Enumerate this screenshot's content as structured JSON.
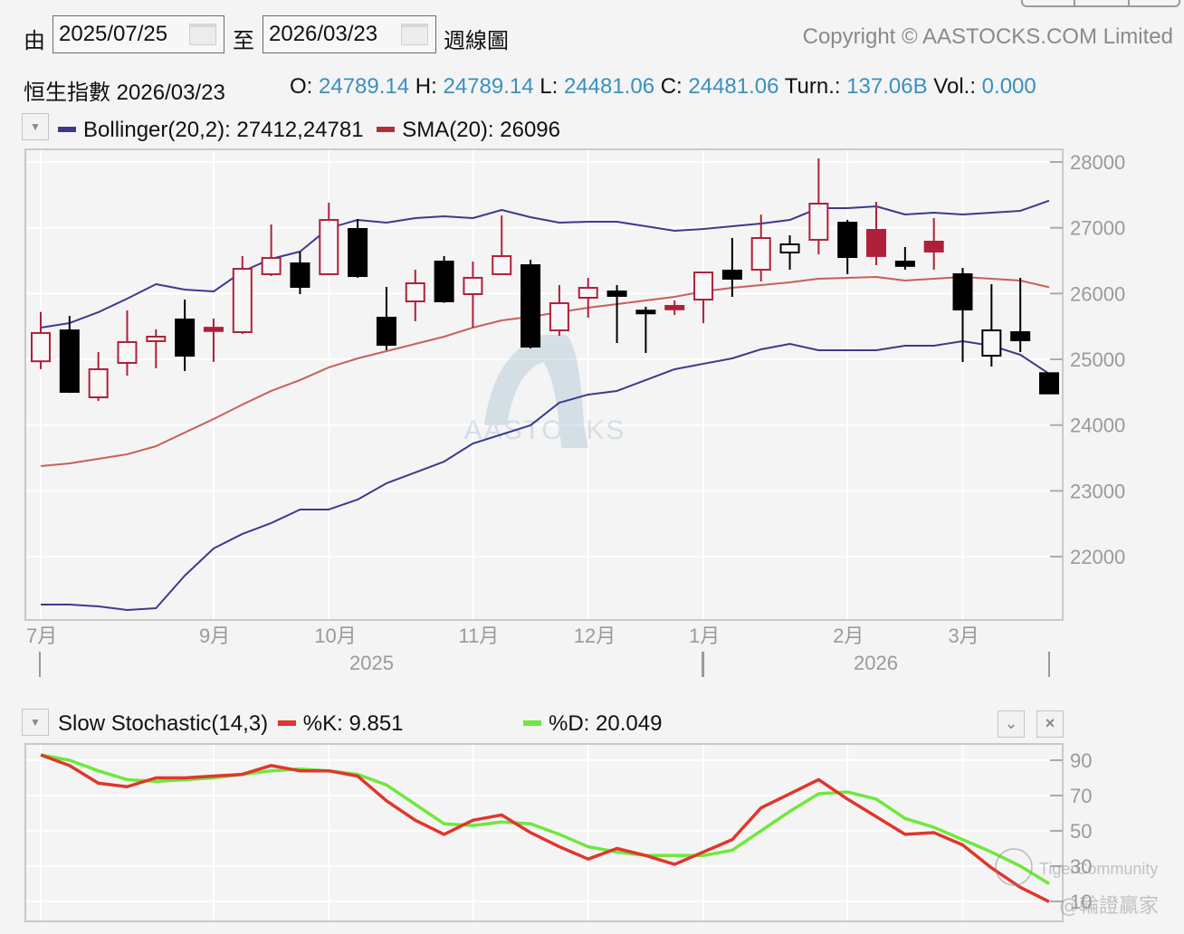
{
  "controls": {
    "from_label": "由",
    "from_date": "2025/07/25",
    "to_label": "至",
    "to_date": "2026/03/23",
    "period_label": "週線圖",
    "copyright": "Copyright © AASTOCKS.COM Limited"
  },
  "quote": {
    "name": "恒生指數",
    "date": "2026/03/23",
    "open_label": "O:",
    "open": "24789.14",
    "high_label": "H:",
    "high": "24789.14",
    "low_label": "L:",
    "low": "24481.06",
    "close_label": "C:",
    "close": "24481.06",
    "turn_label": "Turn.:",
    "turn": "137.06B",
    "vol_label": "Vol.:",
    "vol": "0.000"
  },
  "main_legend": {
    "bollinger": "Bollinger(20,2): 27412,24781",
    "sma": "SMA(20): 26096"
  },
  "stoch_legend": {
    "title": "Slow Stochastic(14,3)",
    "k": "%K: 9.851",
    "d": "%D: 20.049"
  },
  "watermarks": {
    "center": "AASTOCKS",
    "tiger": "TigerCommunity",
    "author": "@輪證贏家"
  },
  "colors": {
    "up": "#b0203a",
    "down": "#000000",
    "bollinger": "#3d3a8c",
    "sma": "#c8605a",
    "k": "#e0362c",
    "d": "#6ee83c",
    "quote_value": "#3a8fc0"
  },
  "chart_data": [
    {
      "type": "candlestick",
      "title": "",
      "y_axis": {
        "position": "right",
        "ticks": [
          22000,
          23000,
          24000,
          25000,
          26000,
          27000,
          28000
        ]
      },
      "x_ticks": [
        {
          "label": "7月",
          "index": 0
        },
        {
          "label": "9月",
          "index": 6
        },
        {
          "label": "10月",
          "index": 10
        },
        {
          "label": "11月",
          "index": 15
        },
        {
          "label": "12月",
          "index": 19
        },
        {
          "label": "1月",
          "index": 23
        },
        {
          "label": "2月",
          "index": 28
        },
        {
          "label": "3月",
          "index": 32
        }
      ],
      "years": [
        {
          "label": "2025",
          "from": 0,
          "to": 23
        },
        {
          "label": "2026",
          "from": 23,
          "to": 35
        }
      ],
      "grid": true,
      "ohlc": [
        [
          24970,
          25720,
          24850,
          25400
        ],
        [
          25440,
          25660,
          24490,
          24505
        ],
        [
          24422,
          25110,
          24367,
          24849
        ],
        [
          24945,
          25743,
          24753,
          25262
        ],
        [
          25276,
          25454,
          24863,
          25344
        ],
        [
          25606,
          25908,
          24821,
          25055
        ],
        [
          25480,
          25620,
          24960,
          25430
        ],
        [
          25413,
          26569,
          25386,
          26376
        ],
        [
          26294,
          27050,
          26266,
          26541
        ],
        [
          26459,
          26638,
          25991,
          26101
        ],
        [
          26294,
          27380,
          26280,
          27119
        ],
        [
          26982,
          27133,
          26240,
          26266
        ],
        [
          25633,
          26101,
          25140,
          25220
        ],
        [
          25881,
          26362,
          25578,
          26156
        ],
        [
          26486,
          26569,
          25860,
          25881
        ],
        [
          25991,
          26486,
          25482,
          26239
        ],
        [
          26294,
          27188,
          26280,
          26569
        ],
        [
          26431,
          26514,
          25165,
          25193
        ],
        [
          25440,
          26129,
          25358,
          25853
        ],
        [
          25936,
          26239,
          25633,
          26087
        ],
        [
          26032,
          26129,
          25248,
          25964
        ],
        [
          25740,
          25798,
          25097,
          25715
        ],
        [
          25812,
          25895,
          25675,
          25760
        ],
        [
          25908,
          26330,
          25550,
          26321
        ],
        [
          26349,
          26844,
          25950,
          26225
        ],
        [
          26362,
          27200,
          26184,
          26844
        ],
        [
          26624,
          26885,
          26362,
          26748
        ],
        [
          26817,
          28055,
          26596,
          27367
        ],
        [
          27078,
          27120,
          26294,
          26555
        ],
        [
          26968,
          27395,
          26431,
          26570
        ],
        [
          26486,
          26707,
          26362,
          26420
        ],
        [
          26789,
          27147,
          26362,
          26638
        ],
        [
          26294,
          26390,
          24959,
          25757
        ],
        [
          25055,
          26142,
          24890,
          25440
        ],
        [
          25413,
          26239,
          25110,
          25289
        ],
        [
          24789.14,
          24789.14,
          24481.06,
          24481.06
        ]
      ],
      "series": [
        {
          "name": "Bollinger(20,2) upper",
          "values": [
            25482,
            25551,
            25716,
            25922,
            26142,
            26060,
            26032,
            26335,
            26528,
            26638,
            26995,
            27119,
            27078,
            27147,
            27174,
            27147,
            27271,
            27161,
            27078,
            27092,
            27092,
            27023,
            26954,
            26982,
            27023,
            27064,
            27119,
            27298,
            27298,
            27326,
            27202,
            27229,
            27202,
            27229,
            27257,
            27412
          ]
        },
        {
          "name": "Bollinger(20,2) lower",
          "values": [
            21271,
            21271,
            21244,
            21189,
            21216,
            21711,
            22124,
            22345,
            22510,
            22716,
            22716,
            22868,
            23115,
            23280,
            23445,
            23720,
            23858,
            23996,
            24340,
            24464,
            24519,
            24684,
            24849,
            24932,
            25014,
            25152,
            25234,
            25138,
            25138,
            25138,
            25207,
            25207,
            25276,
            25207,
            25069,
            24781
          ]
        },
        {
          "name": "SMA(20)",
          "values": [
            23377,
            23418,
            23487,
            23556,
            23679,
            23886,
            24092,
            24312,
            24519,
            24684,
            24877,
            25014,
            25124,
            25234,
            25344,
            25482,
            25592,
            25647,
            25716,
            25785,
            25840,
            25895,
            25950,
            26032,
            26087,
            26129,
            26170,
            26225,
            26239,
            26252,
            26197,
            26225,
            26252,
            26225,
            26197,
            26096
          ]
        }
      ]
    },
    {
      "type": "line",
      "title": "Slow Stochastic(14,3)",
      "y_axis": {
        "position": "right",
        "ticks": [
          10,
          30,
          50,
          70,
          90
        ]
      },
      "grid": true,
      "series": [
        {
          "name": "%K",
          "values": [
            93,
            87,
            77,
            75,
            80,
            80,
            81,
            82,
            87,
            84,
            84,
            81,
            67,
            56,
            48,
            56,
            59,
            49,
            41,
            34,
            40,
            36,
            31,
            38,
            45,
            63,
            71,
            79,
            68,
            58,
            48,
            49,
            42,
            29,
            18,
            9.851
          ]
        },
        {
          "name": "%D",
          "values": [
            93,
            90,
            84,
            79,
            78,
            79,
            80,
            82,
            84,
            85,
            84,
            82,
            76,
            65,
            54,
            53,
            55,
            54,
            48,
            41,
            38,
            36,
            36,
            36,
            39,
            50,
            61,
            71,
            72,
            68,
            57,
            52,
            45,
            38,
            30,
            20.049
          ]
        }
      ]
    }
  ]
}
